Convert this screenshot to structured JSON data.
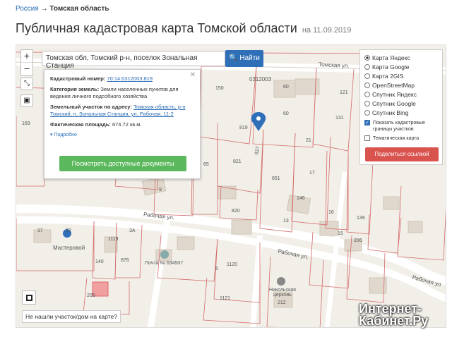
{
  "breadcrumb": {
    "root": "Россия",
    "sep": "→",
    "current": "Томская область"
  },
  "page": {
    "title": "Публичная кадастровая карта Томской области",
    "date": "на 11.09.2019"
  },
  "map": {
    "zoom_in": "+",
    "zoom_out": "−",
    "search": {
      "value": "Томская обл, Томский р-н, поселок Зональная Станция",
      "button": "Найти"
    },
    "popup": {
      "cadastral_label": "Кадастровый номер:",
      "cadastral_number": "70:14:0312003:819",
      "category_label": "Категория земель:",
      "category_value": "Земли населенных пунктов для ведения личного подсобного хозяйства",
      "address_label": "Земельный участок по адресу:",
      "address_value": "Томская область, р-н Томский, п. Зональная Станция, ул. Рабочая, 11-2",
      "area_label": "Фактическая площадь:",
      "area_value": "674.72 кв.м.",
      "more": "Подробно",
      "docs_button": "Посмотреть доступные документы",
      "close": "✕"
    },
    "layers": {
      "options": [
        {
          "label": "Карта Яндекс",
          "selected": true
        },
        {
          "label": "Карта Google",
          "selected": false
        },
        {
          "label": "Карта 2GIS",
          "selected": false
        },
        {
          "label": "OpenStreetMap",
          "selected": false
        },
        {
          "label": "Спутник Яндекс",
          "selected": false
        },
        {
          "label": "Спутник Google",
          "selected": false
        },
        {
          "label": "Спутник Bing",
          "selected": false
        }
      ],
      "show_boundaries": "Показать кадастровые границы участков",
      "thematic": "Тематическая карта",
      "share": "Поделиться ссылкой"
    },
    "not_found": "Не нашли участок/дом на карте?",
    "labels": {
      "street_tomsk": "Томская ул.",
      "street_rab1": "Рабочая ул.",
      "street_rab2": "Рабочая ул.",
      "street_rab3": "Рабочая ул",
      "block": "0312003",
      "masterovoy": "Мастеровой",
      "post": "Почта № 634507",
      "church": "Никольская церковь",
      "n150": "150",
      "n60a": "60",
      "n60b": "60",
      "n121": "121",
      "n131": "131",
      "n21": "21",
      "n819": "819",
      "n821": "821",
      "n651": "651",
      "n17": "17",
      "n65": "65",
      "n9": "9",
      "n820": "820",
      "n146": "146",
      "n13": "13",
      "n16": "16",
      "n15": "15",
      "n139": "139",
      "n206": "206",
      "n37a": "37",
      "n37b": "37",
      "n3a": "3А",
      "n140": "140",
      "n876": "876",
      "n1119": "1119",
      "n1120": "1120",
      "n1121": "1121",
      "n6": "6",
      "n212": "212",
      "n205": "205",
      "n169": "169",
      "n827": "827"
    }
  },
  "watermark": {
    "line1": "Интернет-",
    "line2": "Кабинет.Ру"
  }
}
